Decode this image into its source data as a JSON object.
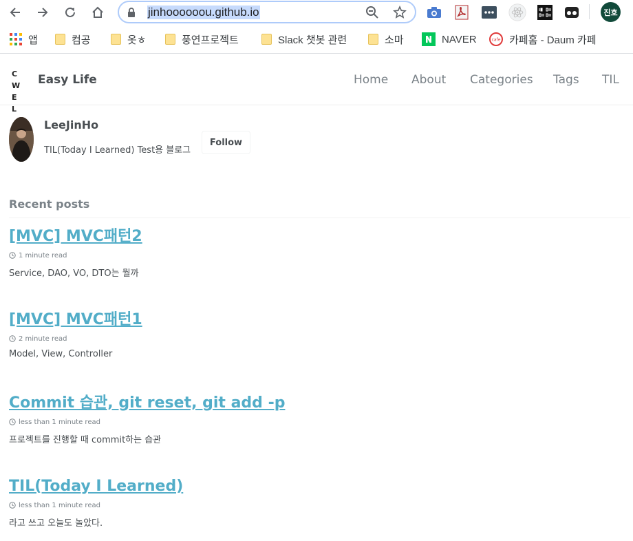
{
  "browser": {
    "url": "jinhoooooou.github.io",
    "profile_initials": "진호"
  },
  "bookmarks": [
    {
      "label": "앱",
      "icon": "apps-grid-icon"
    },
    {
      "label": "컴공",
      "icon": "folder-icon"
    },
    {
      "label": "옷ㅎ",
      "icon": "folder-icon"
    },
    {
      "label": "풍연프로젝트",
      "icon": "folder-icon"
    },
    {
      "label": "Slack 챗봇 관련",
      "icon": "folder-icon"
    },
    {
      "label": "소마",
      "icon": "folder-icon"
    },
    {
      "label": "NAVER",
      "icon": "naver-icon"
    },
    {
      "label": "카페홈 - Daum 카페",
      "icon": "daum-cafe-icon"
    }
  ],
  "site": {
    "logo_letters": "C W E L",
    "title": "Easy Life",
    "nav": [
      "Home",
      "About",
      "Categories",
      "Tags",
      "TIL"
    ]
  },
  "author": {
    "name": "LeeJinHo",
    "bio": "TIL(Today I Learned) Test용 블로그",
    "follow_label": "Follow"
  },
  "recent_heading": "Recent posts",
  "posts": [
    {
      "title": "[MVC] MVC패턴2",
      "read_time": "1 minute read",
      "excerpt": "Service, DAO, VO, DTO는 뭘까"
    },
    {
      "title": "[MVC] MVC패턴1",
      "read_time": "2 minute read",
      "excerpt": "Model, View, Controller"
    },
    {
      "title": "Commit 습관, git reset, git add -p",
      "read_time": "less than 1 minute read",
      "excerpt": "프로젝트를 진행할 때 commit하는 습관"
    },
    {
      "title": "TIL(Today I Learned)",
      "read_time": "less than 1 minute read",
      "excerpt": "라고 쓰고 오늘도 놀았다."
    }
  ]
}
